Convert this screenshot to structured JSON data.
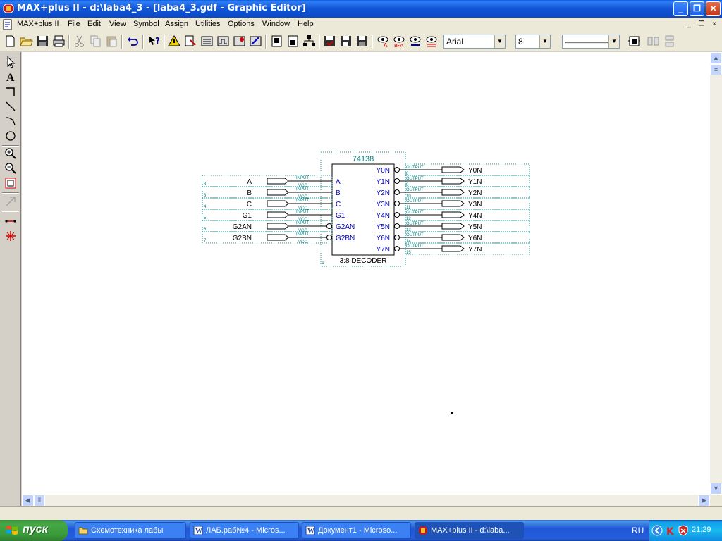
{
  "window": {
    "title": "MAX+plus II - d:\\laba4_3 - [laba4_3.gdf - Graphic Editor]",
    "min_symbol": "_",
    "max_symbol": "❐",
    "close_symbol": "✕"
  },
  "menu": {
    "items": [
      "MAX+plus II",
      "File",
      "Edit",
      "View",
      "Symbol",
      "Assign",
      "Utilities",
      "Options",
      "Window",
      "Help"
    ],
    "mdi_min": "_",
    "mdi_restore": "❐",
    "mdi_close": "×"
  },
  "toolbar": {
    "font_value": "Arial",
    "size_value": "8",
    "line_style_value": "————————"
  },
  "schematic": {
    "part_name": "74138",
    "part_desc": "3:8 DECODER",
    "part_corner": "1",
    "inputs": [
      {
        "name": "A",
        "pin": "A",
        "num": "3",
        "invert": false
      },
      {
        "name": "B",
        "pin": "B",
        "num": "3",
        "invert": false
      },
      {
        "name": "C",
        "pin": "C",
        "num": "4",
        "invert": false
      },
      {
        "name": "G1",
        "pin": "G1",
        "num": "5",
        "invert": false
      },
      {
        "name": "G2AN",
        "pin": "G2AN",
        "num": "6",
        "invert": true
      },
      {
        "name": "G2BN",
        "pin": "G2BN",
        "num": "7",
        "invert": true
      }
    ],
    "outputs": [
      {
        "name": "Y0N",
        "pin": "Y0N",
        "num": "8"
      },
      {
        "name": "Y1N",
        "pin": "Y1N",
        "num": "9"
      },
      {
        "name": "Y2N",
        "pin": "Y2N",
        "num": "10"
      },
      {
        "name": "Y3N",
        "pin": "Y3N",
        "num": "11"
      },
      {
        "name": "Y4N",
        "pin": "Y4N",
        "num": "12"
      },
      {
        "name": "Y5N",
        "pin": "Y5N",
        "num": "13"
      },
      {
        "name": "Y6N",
        "pin": "Y6N",
        "num": "14"
      },
      {
        "name": "Y7N",
        "pin": "Y7N",
        "num": "15"
      }
    ],
    "input_tag": "INPUT",
    "vcc_tag": "VCC",
    "output_tag": "OUTPUT"
  },
  "taskbar": {
    "start_label": "пуск",
    "tasks": [
      {
        "label": "Схемотехника лабы",
        "icon": "folder-icon"
      },
      {
        "label": "ЛАБ.раб№4 - Micros...",
        "icon": "word-icon"
      },
      {
        "label": "Документ1 - Microso...",
        "icon": "word-icon"
      },
      {
        "label": "MAX+plus II - d:\\laba...",
        "icon": "maxplus-icon"
      }
    ],
    "language": "RU",
    "clock": "21:29"
  },
  "colors": {
    "schematic_blue": "#0000c0",
    "schematic_teal": "#008080",
    "dotted_teal": "#1f8f8f",
    "title_blue": "#0a4fd0",
    "start_green": "#3a9b3a"
  }
}
